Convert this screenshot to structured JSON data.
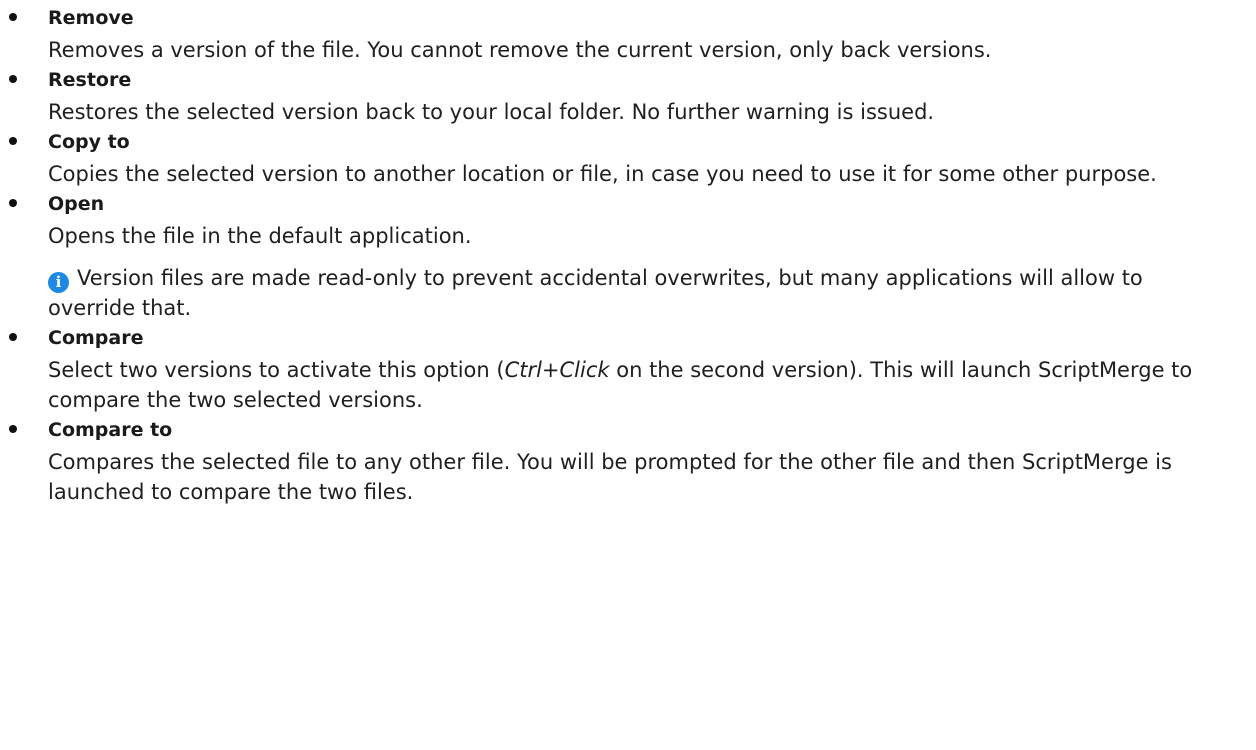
{
  "options": [
    {
      "id": "remove",
      "term": "Remove",
      "description": "Removes a version of the file. You cannot remove the current version, only back versions."
    },
    {
      "id": "restore",
      "term": "Restore",
      "description": "Restores the selected version back to your local folder. No further warning is issued."
    },
    {
      "id": "copy-to",
      "term": "Copy to",
      "description": "Copies the selected version to another location or file, in case you need to use it for some other purpose."
    },
    {
      "id": "open",
      "term": "Open",
      "description": "Opens the file in the default application.",
      "note": "Version files are made read-only to prevent accidental overwrites, but many applications will allow to override that.",
      "note_icon": "info-icon"
    },
    {
      "id": "compare",
      "term": "Compare",
      "description_before": "Select two versions to activate this option (",
      "description_emph": "Ctrl+Click",
      "description_after": " on the second version). This will launch ScriptMerge to compare the two selected versions."
    },
    {
      "id": "compare-to",
      "term": "Compare to",
      "description": "Compares the selected file to any other file. You will be prompted for the other file and then ScriptMerge is launched to compare the two files."
    }
  ],
  "colors": {
    "text": "#1f1f1f",
    "info_icon": "#1e88e5"
  }
}
